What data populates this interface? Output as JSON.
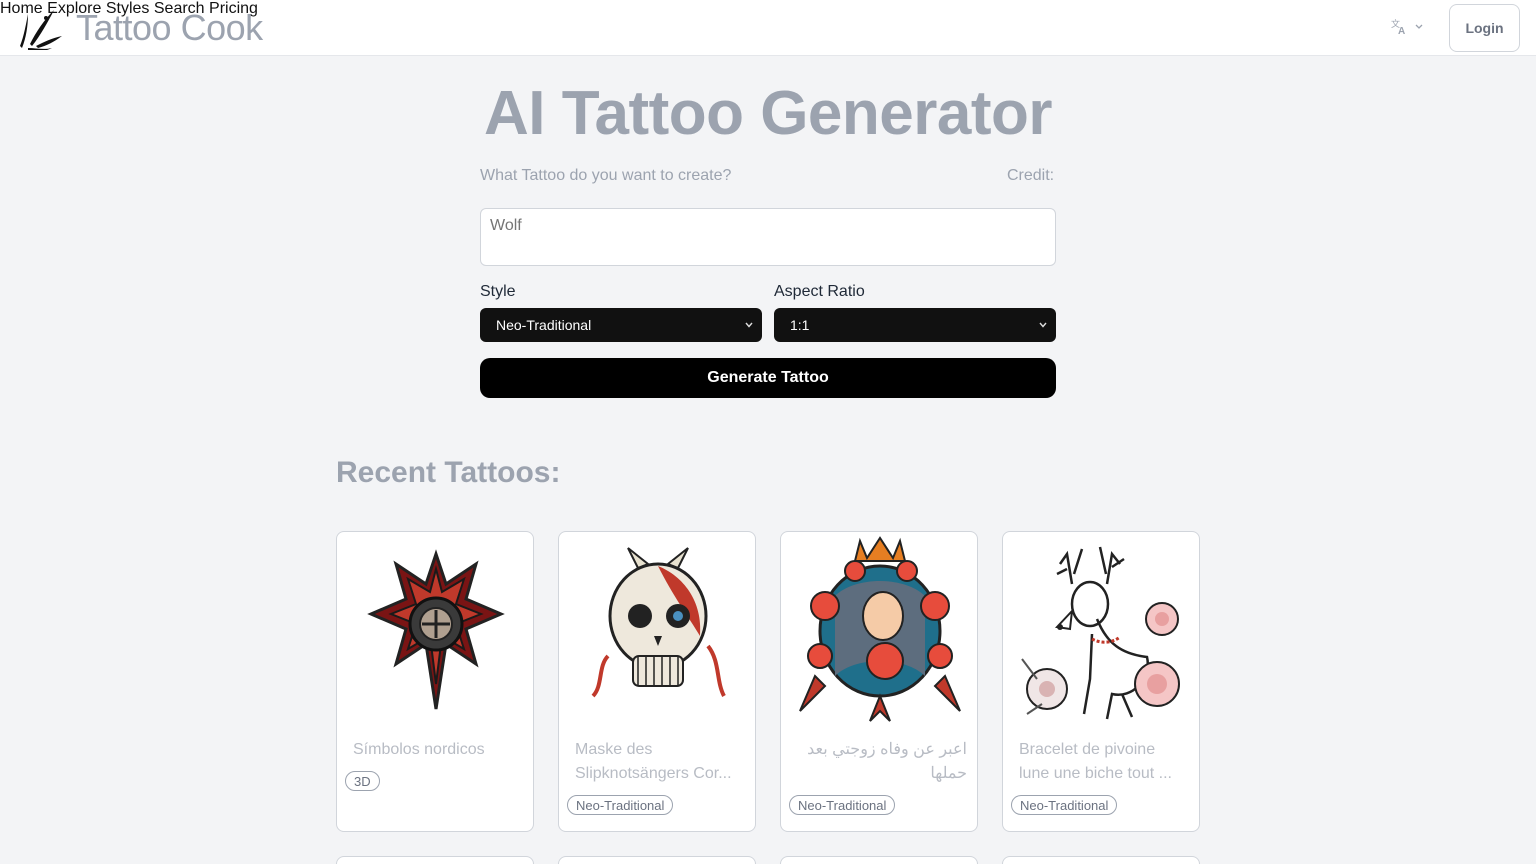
{
  "header": {
    "brand": "Tattoo Cook",
    "nav": [
      "Home",
      "Explore",
      "Styles",
      "Search",
      "Pricing"
    ],
    "language_icon": "translate-icon",
    "login_label": "Login"
  },
  "hero": {
    "title": "AI Tattoo Generator",
    "prompt_label": "What Tattoo do you want to create?",
    "credit_label": "Credit:",
    "prompt_placeholder": "Wolf",
    "style_label": "Style",
    "style_value": "Neo-Traditional",
    "aspect_label": "Aspect Ratio",
    "aspect_value": "1:1",
    "generate_label": "Generate Tattoo"
  },
  "recent": {
    "title": "Recent Tattoos:",
    "cards": [
      {
        "title": "Símbolos nordicos",
        "badge": "3D"
      },
      {
        "title": "Maske des Slipknotsängers Cor...",
        "badge": "Neo-Traditional"
      },
      {
        "title": "اعبر عن وفاه زوجتي بعد حملها",
        "badge": "Neo-Traditional"
      },
      {
        "title": "Bracelet de pivoine lune une biche tout ...",
        "badge": "Neo-Traditional"
      }
    ]
  }
}
